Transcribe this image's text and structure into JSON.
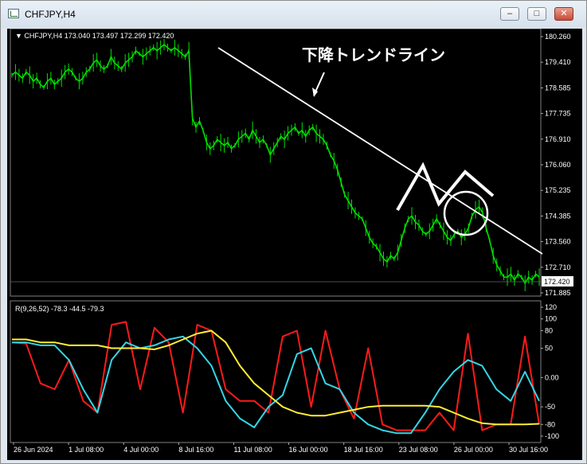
{
  "window": {
    "title": "CHFJPY,H4",
    "buttons": {
      "minimize": "–",
      "maximize": "□",
      "close": "✕"
    }
  },
  "colors": {
    "background": "#000000",
    "price_line": "#00e000",
    "trendline": "#ffffff",
    "red_line": "#ff1a1a",
    "cyan_line": "#33d6e6",
    "yellow_line": "#ffee33",
    "axis_text": "#ffffff"
  },
  "chart_data": [
    {
      "type": "line",
      "header": "▼ CHFJPY,H4 173.040 173.497 172.299 172.420",
      "price_label": "172.420",
      "yticks": [
        "180.260",
        "179.410",
        "178.585",
        "177.735",
        "176.910",
        "176.060",
        "175.235",
        "174.385",
        "173.560",
        "172.710",
        "171.885"
      ],
      "ylim": [
        171.885,
        180.26
      ],
      "annotation": "下降トレンドライン",
      "x": [
        0,
        1,
        2,
        3,
        4,
        5,
        6,
        7,
        8,
        9,
        10,
        11,
        12,
        13,
        14,
        15,
        16,
        17,
        18,
        19,
        20,
        21,
        22,
        23,
        24,
        25,
        26,
        27,
        28,
        29,
        30,
        31,
        32,
        33,
        34,
        35,
        36,
        37,
        38,
        39,
        40,
        41,
        42,
        43,
        44,
        45,
        46,
        47,
        48,
        49,
        50,
        51,
        52,
        53,
        54,
        55,
        56,
        57,
        58,
        59,
        60,
        61,
        62,
        63,
        64,
        65,
        66,
        67,
        68,
        69,
        70,
        71,
        72,
        73,
        74,
        75,
        76,
        77,
        78,
        79,
        80,
        81,
        82,
        83,
        84,
        85,
        86,
        87,
        88,
        89,
        90,
        91,
        92,
        93,
        94,
        95,
        96,
        97,
        98,
        99,
        100,
        101,
        102,
        103,
        104,
        105,
        106,
        107,
        108,
        109,
        110,
        111,
        112,
        113,
        114,
        115,
        116,
        117,
        118,
        119,
        120,
        121,
        122,
        123,
        124,
        125,
        126,
        127,
        128,
        129,
        130,
        131,
        132,
        133,
        134,
        135,
        136,
        137,
        138,
        139,
        140,
        141,
        142,
        143,
        144,
        145,
        146,
        147,
        148,
        149
      ],
      "series": [
        {
          "values": [
            179.0,
            179.1,
            179.0,
            178.9,
            179.1,
            179.0,
            178.8,
            178.9,
            178.7,
            178.6,
            178.8,
            178.9,
            178.7,
            178.8,
            178.9,
            179.1,
            179.2,
            179.1,
            178.9,
            178.8,
            178.9,
            179.1,
            179.2,
            179.4,
            179.5,
            179.3,
            179.2,
            179.3,
            179.6,
            179.4,
            179.3,
            179.2,
            179.4,
            179.5,
            179.6,
            179.8,
            179.7,
            179.6,
            179.7,
            179.8,
            179.9,
            179.8,
            179.9,
            180.0,
            179.9,
            179.8,
            179.9,
            179.8,
            179.7,
            179.6,
            179.8,
            177.6,
            177.3,
            177.5,
            177.2,
            176.8,
            176.6,
            176.7,
            176.9,
            176.8,
            176.7,
            176.8,
            176.6,
            176.7,
            176.9,
            177.0,
            177.1,
            176.9,
            177.2,
            177.0,
            176.8,
            176.9,
            176.7,
            176.4,
            176.6,
            176.8,
            177.0,
            176.9,
            177.1,
            177.2,
            177.3,
            177.1,
            177.2,
            177.0,
            177.2,
            177.3,
            177.1,
            177.0,
            176.9,
            176.7,
            176.4,
            176.2,
            175.9,
            175.5,
            175.1,
            174.9,
            174.7,
            174.5,
            174.4,
            174.3,
            174.0,
            173.7,
            173.5,
            173.4,
            173.2,
            173.0,
            172.9,
            173.1,
            173.0,
            173.2,
            173.6,
            174.0,
            174.3,
            174.4,
            174.2,
            174.1,
            173.9,
            173.8,
            173.9,
            174.1,
            174.3,
            174.1,
            173.9,
            173.7,
            173.6,
            173.8,
            173.9,
            173.7,
            173.8,
            174.0,
            174.4,
            174.6,
            174.7,
            174.5,
            174.0,
            173.6,
            173.1,
            172.8,
            172.6,
            172.4,
            172.4,
            172.5,
            172.3,
            172.5,
            172.4,
            172.2,
            172.4,
            172.3,
            172.5,
            172.4
          ]
        }
      ]
    },
    {
      "type": "line",
      "header": "R(9,26,52) -78.3 -44.5 -79.3",
      "yticks": [
        "120",
        "100",
        "80",
        "50",
        "0.00",
        "-50",
        "-80",
        "-100"
      ],
      "ylim": [
        -100,
        120
      ],
      "xticks": [
        "26 Jun 2024",
        "1 Jul 08:00",
        "4 Jul 00:00",
        "8 Jul 16:00",
        "11 Jul 08:00",
        "16 Jul 00:00",
        "18 Jul 16:00",
        "23 Jul 08:00",
        "26 Jul 00:00",
        "30 Jul 16:00"
      ],
      "x": [
        0,
        4,
        8,
        12,
        16,
        20,
        24,
        28,
        32,
        36,
        40,
        44,
        48,
        52,
        56,
        60,
        64,
        68,
        72,
        76,
        80,
        84,
        88,
        92,
        96,
        100,
        104,
        108,
        112,
        116,
        120,
        124,
        128,
        132,
        136,
        140,
        144,
        148
      ],
      "series": [
        {
          "values": [
            60,
            58,
            -10,
            -20,
            30,
            -40,
            -60,
            90,
            95,
            -20,
            85,
            60,
            -60,
            90,
            80,
            -20,
            -40,
            -40,
            -60,
            70,
            80,
            -50,
            80,
            -20,
            -70,
            50,
            -80,
            -90,
            -90,
            -90,
            -60,
            -90,
            75,
            -90,
            -80,
            -80,
            70,
            -80
          ]
        },
        {
          "values": [
            60,
            60,
            55,
            55,
            30,
            -20,
            -60,
            30,
            60,
            50,
            55,
            65,
            70,
            50,
            20,
            -40,
            -70,
            -85,
            -50,
            -30,
            40,
            50,
            -10,
            -20,
            -60,
            -80,
            -90,
            -95,
            -95,
            -60,
            -20,
            10,
            30,
            20,
            -20,
            -40,
            10,
            -40
          ]
        },
        {
          "values": [
            65,
            65,
            60,
            60,
            55,
            55,
            55,
            50,
            50,
            50,
            48,
            55,
            65,
            75,
            80,
            60,
            20,
            -10,
            -30,
            -50,
            -60,
            -65,
            -65,
            -60,
            -55,
            -50,
            -48,
            -48,
            -48,
            -48,
            -50,
            -60,
            -70,
            -78,
            -80,
            -80,
            -80,
            -79
          ]
        }
      ]
    }
  ]
}
